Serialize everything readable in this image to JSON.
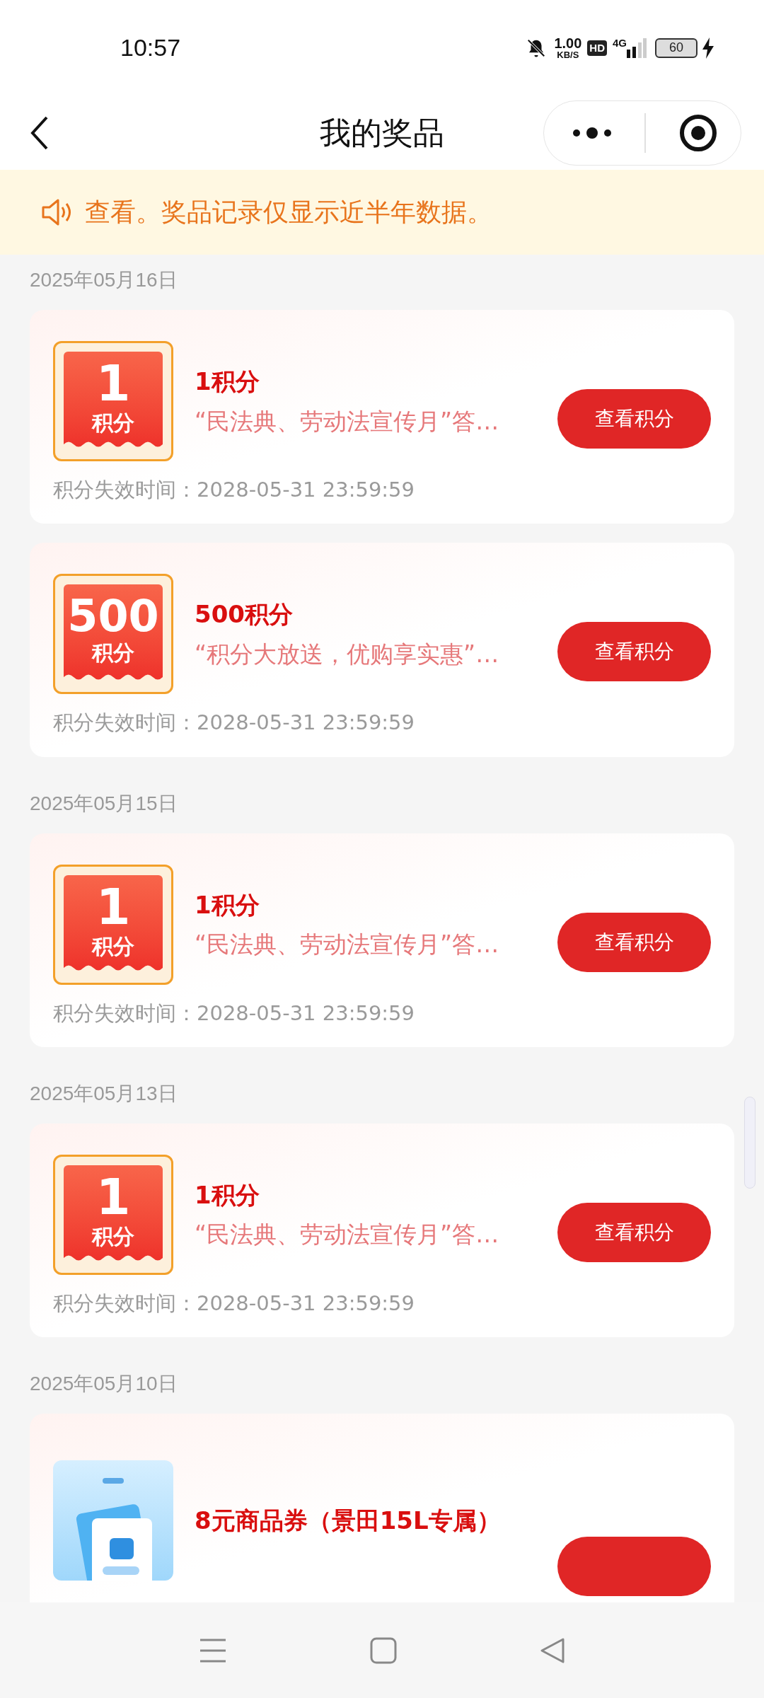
{
  "status_bar": {
    "time": "10:57",
    "net_speed": "1.00",
    "net_unit": "KB/S",
    "hd": "HD",
    "network": "4G",
    "battery": "60"
  },
  "header": {
    "title": "我的奖品"
  },
  "notice": {
    "text": "查看。奖品记录仅显示近半年数据。"
  },
  "groups": [
    {
      "date": "2025年05月16日",
      "prizes": [
        {
          "kind": "points",
          "badge_value": "1",
          "badge_unit": "积分",
          "title": "1积分",
          "description": "“民法典、劳动法宣传月”答…",
          "expiry": "积分失效时间：2028-05-31 23:59:59",
          "button": "查看积分"
        },
        {
          "kind": "points",
          "badge_value": "500",
          "badge_unit": "积分",
          "title": "500积分",
          "description": "“积分大放送，优购享实惠”…",
          "expiry": "积分失效时间：2028-05-31 23:59:59",
          "button": "查看积分"
        }
      ]
    },
    {
      "date": "2025年05月15日",
      "prizes": [
        {
          "kind": "points",
          "badge_value": "1",
          "badge_unit": "积分",
          "title": "1积分",
          "description": "“民法典、劳动法宣传月”答…",
          "expiry": "积分失效时间：2028-05-31 23:59:59",
          "button": "查看积分"
        }
      ]
    },
    {
      "date": "2025年05月13日",
      "prizes": [
        {
          "kind": "points",
          "badge_value": "1",
          "badge_unit": "积分",
          "title": "1积分",
          "description": "“民法典、劳动法宣传月”答…",
          "expiry": "积分失效时间：2028-05-31 23:59:59",
          "button": "查看积分"
        }
      ]
    },
    {
      "date": "2025年05月10日",
      "prizes": [
        {
          "kind": "coupon",
          "title": "8元商品券（景田15L专属）"
        }
      ]
    }
  ]
}
